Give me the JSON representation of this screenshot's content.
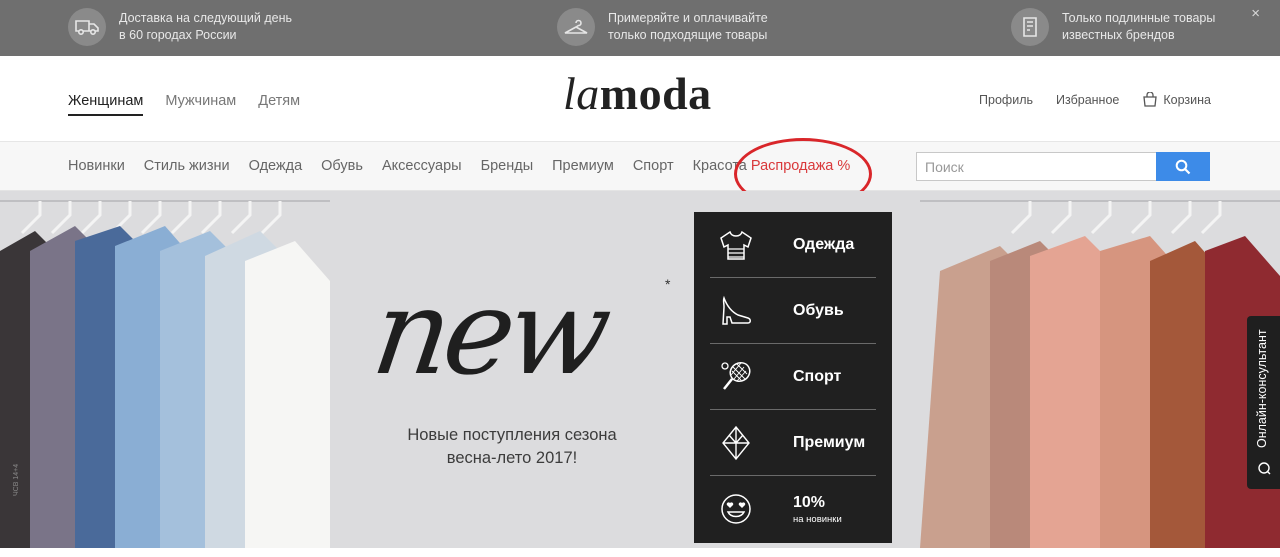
{
  "promo": [
    {
      "line1": "Доставка на следующий день",
      "line2": "в 60 городах России",
      "icon": "truck-icon"
    },
    {
      "line1": "Примеряйте и оплачивайте",
      "line2": "только подходящие товары",
      "icon": "hanger-icon"
    },
    {
      "line1": "Только подлинные товары",
      "line2": "известных брендов",
      "icon": "tag-icon"
    }
  ],
  "promo_close": "×",
  "header": {
    "gender": [
      "Женщинам",
      "Мужчинам",
      "Детям"
    ],
    "logo_la": "la",
    "logo_moda": "moda",
    "profile": "Профиль",
    "favorites": "Избранное",
    "cart": "Корзина"
  },
  "nav": {
    "categories": [
      "Новинки",
      "Стиль жизни",
      "Одежда",
      "Обувь",
      "Аксессуары",
      "Бренды",
      "Премиум",
      "Спорт",
      "Красота"
    ],
    "sale": "Распродажа %"
  },
  "search": {
    "placeholder": "Поиск"
  },
  "banner": {
    "headline": "new",
    "star": "*",
    "subtitle_line1": "Новые поступления сезона",
    "subtitle_line2": "весна-лето 2017!",
    "panel": [
      {
        "label": "Одежда",
        "icon": "sweater-icon"
      },
      {
        "label": "Обувь",
        "icon": "high-heel-icon"
      },
      {
        "label": "Спорт",
        "icon": "tennis-racket-icon"
      },
      {
        "label": "Премиум",
        "icon": "diamond-icon"
      },
      {
        "label": "10%",
        "sublabel": "на новинки",
        "icon": "smiley-icon"
      }
    ],
    "consultant": "Онлайн-консультант",
    "side_code": "ЧСВ 14+4"
  },
  "colors": {
    "accent": "#3d8be8",
    "sale": "#d9383a",
    "panel": "#202020"
  }
}
